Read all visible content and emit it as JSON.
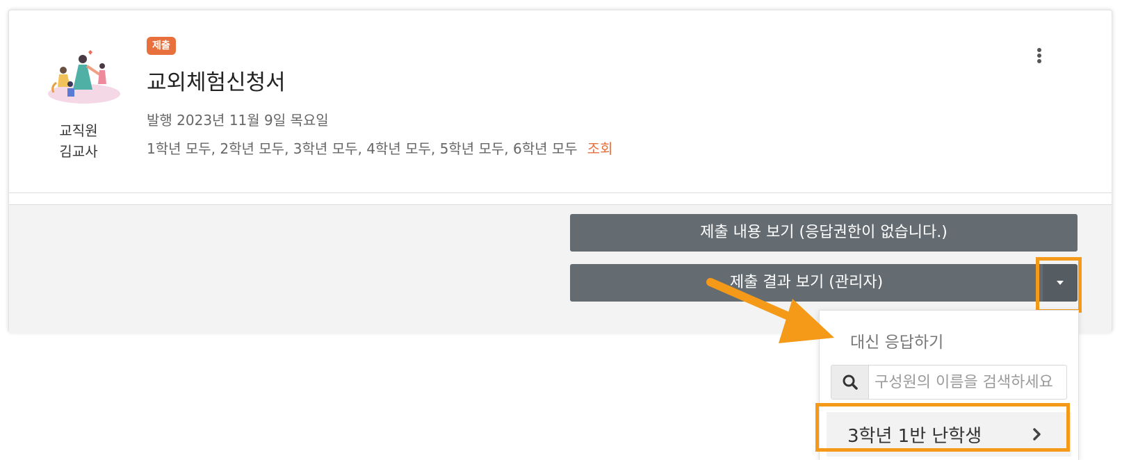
{
  "author": {
    "role": "교직원",
    "name": "김교사"
  },
  "post": {
    "badge": "제출",
    "title": "교외체험신청서",
    "publish_date": "발행 2023년 11월 9일 목요일",
    "audience": "1학년 모두, 2학년 모두, 3학년 모두, 4학년 모두, 5학년 모두, 6학년 모두",
    "view_link": "조회"
  },
  "actions": {
    "view_submission": "제출 내용 보기 (응답권한이 없습니다.)",
    "view_results": "제출 결과 보기 (관리자)"
  },
  "dropdown": {
    "header": "대신 응답하기",
    "search_placeholder": "구성원의 이름을 검색하세요",
    "members": [
      "3학년 1반 난학생"
    ]
  },
  "colors": {
    "accent_orange": "#e8703c",
    "button_gray": "#646c72",
    "highlight": "#f59a18"
  },
  "icons": [
    "kebab-menu-icon",
    "caret-down-icon",
    "search-icon",
    "chevron-right-icon",
    "pointer-arrow-icon"
  ]
}
